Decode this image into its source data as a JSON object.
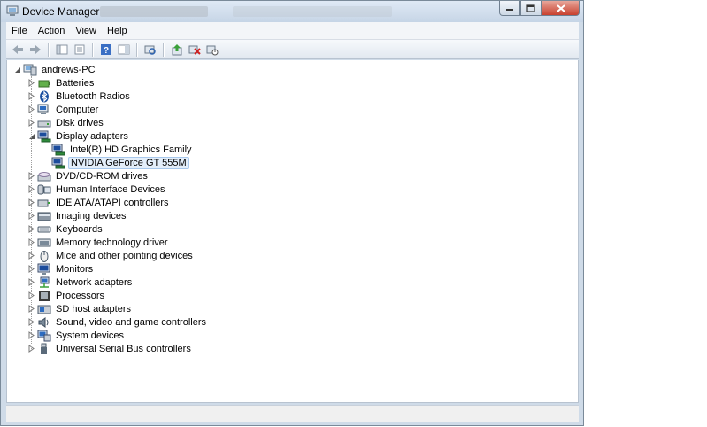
{
  "window": {
    "title": "Device Manager"
  },
  "menu": [
    {
      "label": "File",
      "key": "F",
      "rest": "ile"
    },
    {
      "label": "Action",
      "key": "A",
      "rest": "ction"
    },
    {
      "label": "View",
      "key": "V",
      "rest": "iew"
    },
    {
      "label": "Help",
      "key": "H",
      "rest": "elp"
    }
  ],
  "toolbar": [
    "back-icon",
    "forward-icon",
    "show-hide-console-tree-icon",
    "properties-pane-icon",
    "help-icon",
    "action-pane-icon",
    "scan-hardware-icon",
    "update-driver-icon",
    "uninstall-icon",
    "disable-device-icon"
  ],
  "tree": {
    "root": "andrews-PC",
    "categories": [
      {
        "label": "Batteries",
        "icon": "battery-icon"
      },
      {
        "label": "Bluetooth Radios",
        "icon": "bluetooth-icon"
      },
      {
        "label": "Computer",
        "icon": "computer-icon"
      },
      {
        "label": "Disk drives",
        "icon": "disk-drive-icon"
      },
      {
        "label": "Display adapters",
        "icon": "display-adapter-icon",
        "expanded": true,
        "children": [
          {
            "label": "Intel(R) HD Graphics Family",
            "icon": "display-adapter-icon"
          },
          {
            "label": "NVIDIA GeForce GT 555M",
            "icon": "display-adapter-icon",
            "selected": true
          }
        ]
      },
      {
        "label": "DVD/CD-ROM drives",
        "icon": "dvd-drive-icon"
      },
      {
        "label": "Human Interface Devices",
        "icon": "hid-icon"
      },
      {
        "label": "IDE ATA/ATAPI controllers",
        "icon": "ide-controller-icon"
      },
      {
        "label": "Imaging devices",
        "icon": "imaging-device-icon"
      },
      {
        "label": "Keyboards",
        "icon": "keyboard-icon"
      },
      {
        "label": "Memory technology driver",
        "icon": "memory-icon"
      },
      {
        "label": "Mice and other pointing devices",
        "icon": "mouse-icon"
      },
      {
        "label": "Monitors",
        "icon": "monitor-icon"
      },
      {
        "label": "Network adapters",
        "icon": "network-adapter-icon"
      },
      {
        "label": "Processors",
        "icon": "processor-icon"
      },
      {
        "label": "SD host adapters",
        "icon": "sd-host-icon"
      },
      {
        "label": "Sound, video and game controllers",
        "icon": "sound-icon"
      },
      {
        "label": "System devices",
        "icon": "system-device-icon"
      },
      {
        "label": "Universal Serial Bus controllers",
        "icon": "usb-icon"
      }
    ]
  },
  "colors": {
    "selection_bg": "#e3eefa",
    "selection_border": "#a8c8ec",
    "window_frame": "#cfdbe8"
  }
}
